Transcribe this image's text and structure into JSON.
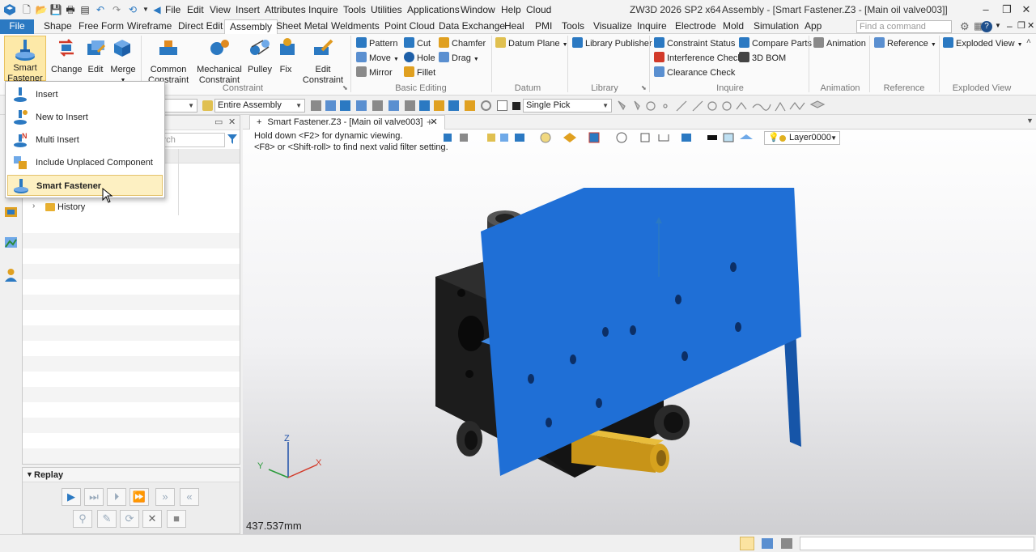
{
  "titlebar": {
    "menu": [
      "File",
      "Edit",
      "View",
      "Insert",
      "Attributes",
      "Inquire",
      "Tools",
      "Utilities",
      "Applications",
      "Window",
      "Help",
      "Cloud"
    ],
    "app_version": "ZW3D 2026 SP2 x64",
    "window_title": "Assembly - [Smart Fastener.Z3 - [Main oil valve003]]",
    "window_controls": [
      "–",
      "❐",
      "✕"
    ]
  },
  "tabs": [
    "File",
    "Shape",
    "Free Form",
    "Wireframe",
    "Direct Edit",
    "Assembly",
    "Sheet Metal",
    "Weldments",
    "Point Cloud",
    "Data Exchange",
    "Heal",
    "PMI",
    "Tools",
    "Visualize",
    "Inquire",
    "Electrode",
    "Mold",
    "Simulation",
    "App"
  ],
  "active_tab": "Assembly",
  "command_search": {
    "placeholder": "Find a command"
  },
  "ribbon": {
    "smart_fastener": "Smart\nFastener",
    "smart_fastener_l1": "Smart",
    "smart_fastener_l2": "Fastener",
    "change": "Change",
    "edit": "Edit",
    "merge": "Merge",
    "common_constraint_l1": "Common",
    "common_constraint_l2": "Constraint",
    "mechanical_constraint_l1": "Mechanical",
    "mechanical_constraint_l2": "Constraint",
    "pulley": "Pulley",
    "fix": "Fix",
    "edit_constraint_l1": "Edit",
    "edit_constraint_l2": "Constraint",
    "pattern": "Pattern",
    "cut": "Cut",
    "chamfer": "Chamfer",
    "move": "Move",
    "hole": "Hole",
    "drag": "Drag",
    "mirror": "Mirror",
    "fillet": "Fillet",
    "datum_plane": "Datum Plane",
    "library_publisher": "Library Publisher",
    "constraint_status": "Constraint Status",
    "compare_parts": "Compare Parts",
    "interference_check": "Interference Check",
    "bom_3d": "3D BOM",
    "clearance_check": "Clearance Check",
    "animation": "Animation",
    "reference": "Reference",
    "exploded_view": "Exploded View",
    "groups": {
      "constraint": "Constraint",
      "basic_editing": "Basic Editing",
      "datum": "Datum",
      "library": "Library",
      "inquire": "Inquire",
      "animation": "Animation",
      "reference": "Reference",
      "exploded_view": "Exploded View"
    }
  },
  "dropdown": {
    "items": [
      "Insert",
      "New to Insert",
      "Multi Insert",
      "Include Unplaced Component",
      "Smart Fastener"
    ],
    "highlighted": "Smart Fastener"
  },
  "toolbar2": {
    "filter_scope": "Entire Assembly",
    "pick_mode": "Single Pick"
  },
  "manager": {
    "search_placeholder": "Search",
    "history_label": "History"
  },
  "replay": {
    "title": "Replay"
  },
  "viewport": {
    "doc_tab": "Smart Fastener.Z3 - [Main oil valve003]",
    "hint_line1": "Hold down <F2> for dynamic viewing.",
    "hint_line2": "<F8> or <Shift-roll> to find next valid filter setting.",
    "layer": "Layer0000",
    "scale_readout": "437.537mm",
    "triad": {
      "x": "X",
      "y": "Y",
      "z": "Z"
    }
  },
  "colors": {
    "accent": "#2b79c2",
    "plate": "#1f6fd6",
    "block": "#1c1c1c",
    "brass": "#d6a21e",
    "highlight": "#fdf0c2"
  }
}
